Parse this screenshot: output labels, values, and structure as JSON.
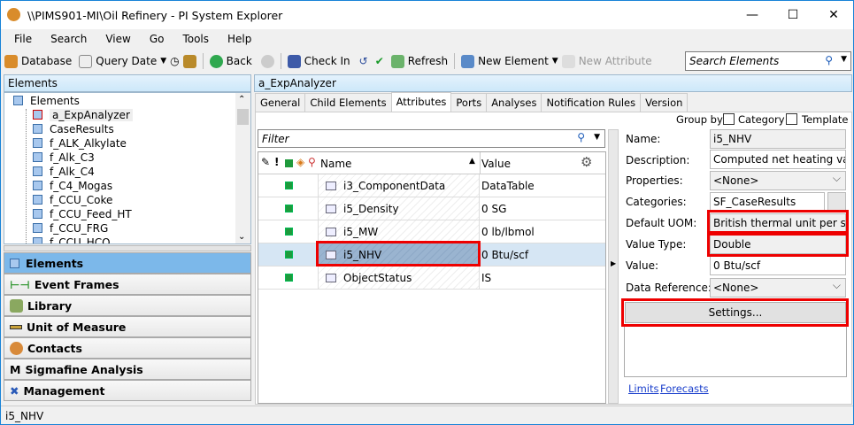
{
  "window": {
    "title": "\\\\PIMS901-MI\\Oil Refinery - PI System Explorer"
  },
  "menu": [
    "File",
    "Search",
    "View",
    "Go",
    "Tools",
    "Help"
  ],
  "toolbar": {
    "database": "Database",
    "query_date": "Query Date",
    "back": "Back",
    "check_in": "Check In",
    "refresh": "Refresh",
    "new_element": "New Element",
    "new_attribute": "New Attribute",
    "search_placeholder": "Search Elements"
  },
  "left": {
    "header": "Elements",
    "tree_root": "Elements",
    "tree_items": [
      "a_ExpAnalyzer",
      "CaseResults",
      "f_ALK_Alkylate",
      "f_Alk_C3",
      "f_Alk_C4",
      "f_C4_Mogas",
      "f_CCU_Coke",
      "f_CCU_Feed_HT",
      "f_CCU_FRG",
      "f_CCU_HCO"
    ],
    "nav": [
      "Elements",
      "Event Frames",
      "Library",
      "Unit of Measure",
      "Contacts",
      "Sigmafine Analysis",
      "Management"
    ]
  },
  "main": {
    "header": "a_ExpAnalyzer",
    "tabs": [
      "General",
      "Child Elements",
      "Attributes",
      "Ports",
      "Analyses",
      "Notification Rules",
      "Version"
    ],
    "group_by": "Group by:",
    "category": "Category",
    "template": "Template",
    "filter_placeholder": "Filter",
    "columns": {
      "name": "Name",
      "value": "Value"
    },
    "rows": [
      {
        "name": "i3_ComponentData",
        "value": "DataTable"
      },
      {
        "name": "i5_Density",
        "value": "0 SG"
      },
      {
        "name": "i5_MW",
        "value": "0 lb/lbmol"
      },
      {
        "name": "i5_NHV",
        "value": "0 Btu/scf"
      },
      {
        "name": "ObjectStatus",
        "value": "IS"
      }
    ]
  },
  "props": {
    "name_label": "Name:",
    "name": "i5_NHV",
    "description_label": "Description:",
    "description": "Computed net heating value fo",
    "properties_label": "Properties:",
    "properties": "<None>",
    "categories_label": "Categories:",
    "categories": "SF_CaseResults",
    "uom_label": "Default UOM:",
    "uom": "British thermal unit per stan…",
    "value_type_label": "Value Type:",
    "value_type": "Double",
    "value_label": "Value:",
    "value": "0 Btu/scf",
    "data_ref_label": "Data Reference:",
    "data_ref": "<None>",
    "settings": "Settings...",
    "limits": "Limits",
    "forecasts": "Forecasts"
  },
  "status": "i5_NHV"
}
